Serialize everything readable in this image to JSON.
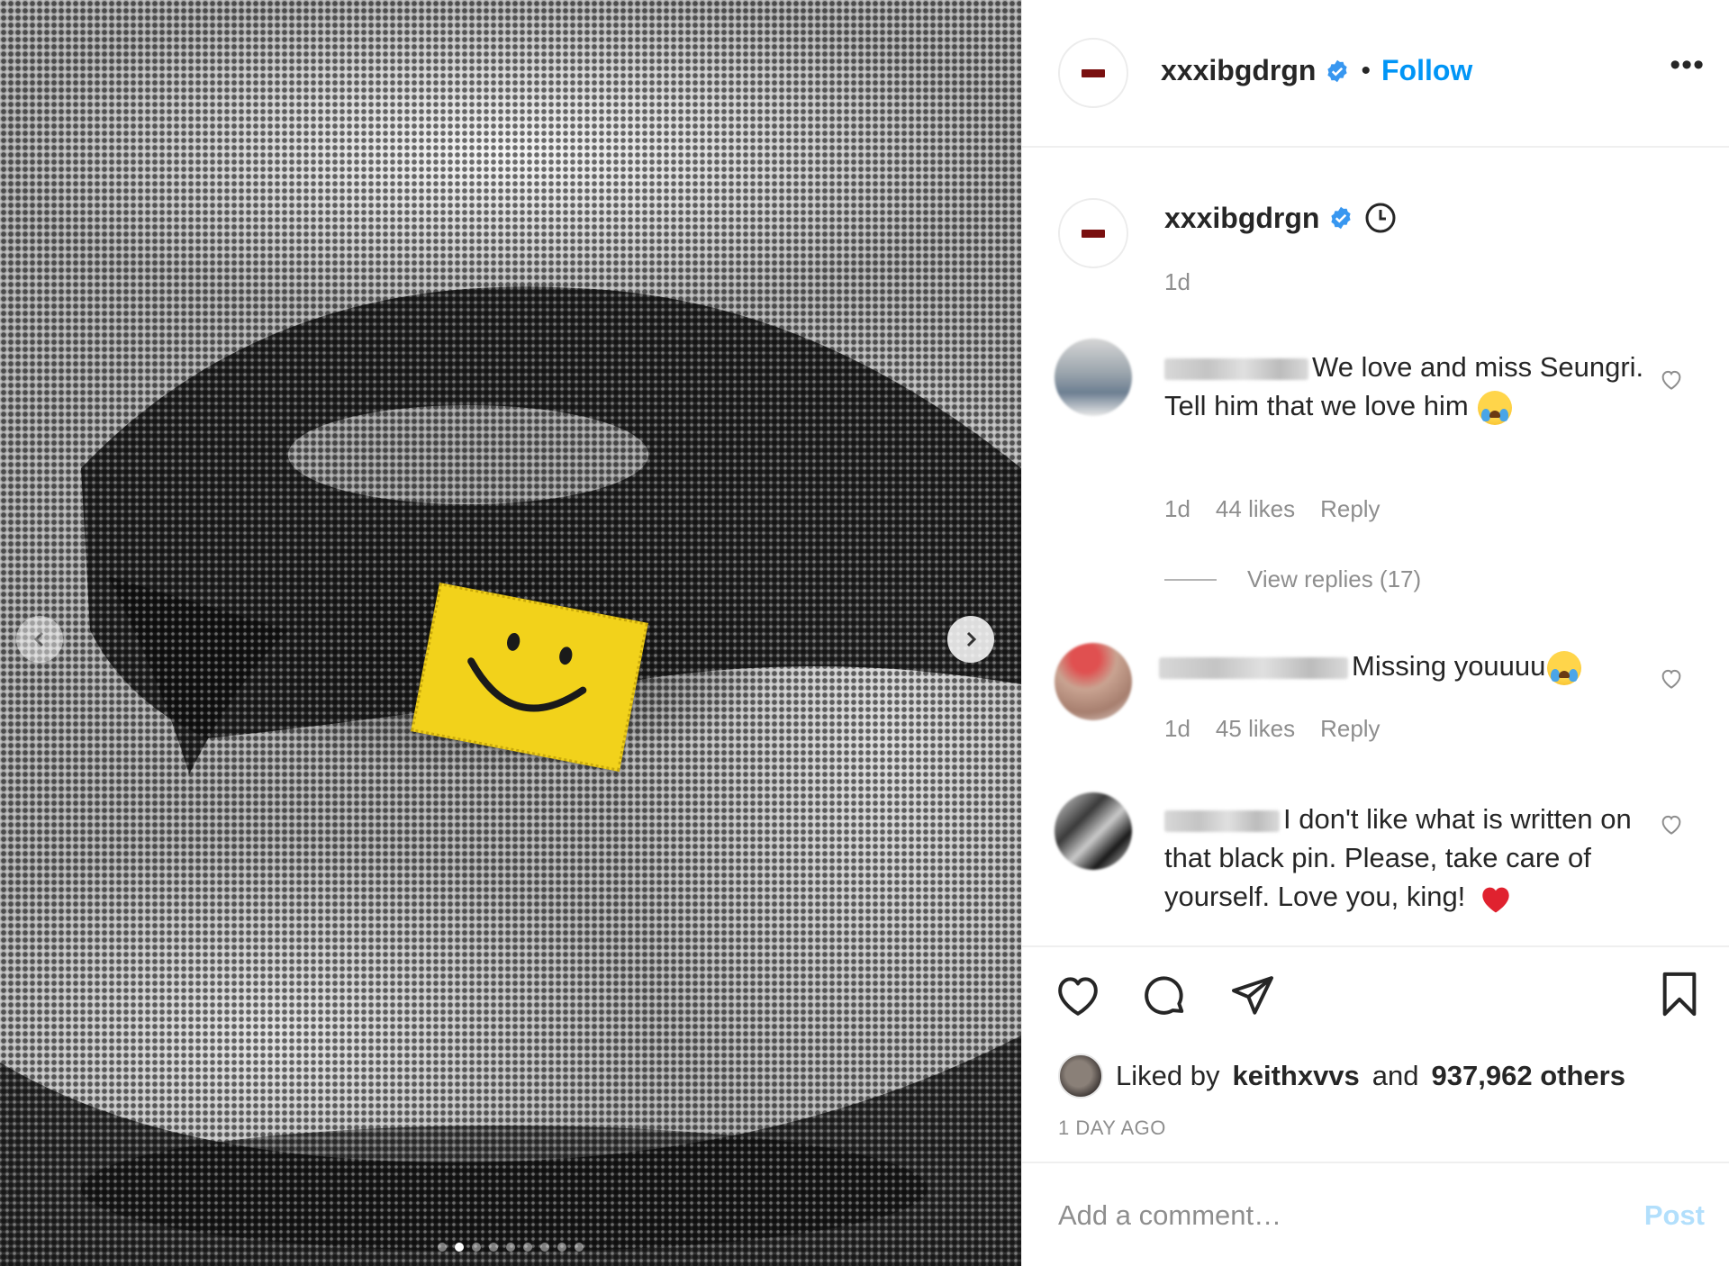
{
  "post": {
    "author": "xxxibgdrgn",
    "follow_label": "Follow",
    "separator": "•",
    "more_label": "•••",
    "caption_time": "1d",
    "carousel": {
      "slide_count": 9,
      "active_index": 1
    }
  },
  "comments": [
    {
      "text": "We love and miss Seungri. Tell him that we love him",
      "emoji": "crying-face",
      "time": "1d",
      "likes": "44 likes",
      "reply_label": "Reply",
      "view_replies": "View replies (17)"
    },
    {
      "text": "Missing youuuu",
      "emoji": "crying-face",
      "time": "1d",
      "likes": "45 likes",
      "reply_label": "Reply"
    },
    {
      "text": "I don't like what is written on that black pin. Please, take care of yourself. Love you, king!",
      "emoji": "red-heart"
    }
  ],
  "likes": {
    "prefix": "Liked by",
    "user": "keithxvvs",
    "conjunction": "and",
    "others": "937,962 others"
  },
  "post_date": "1 DAY AGO",
  "comment_box": {
    "placeholder": "Add a comment…",
    "post_label": "Post"
  },
  "colors": {
    "accent": "#0095f6",
    "post_disabled": "#b2dffc",
    "muted": "#8e8e8e",
    "text": "#262626",
    "sticker": "#f2d21b",
    "heart_red": "#ed4956"
  }
}
